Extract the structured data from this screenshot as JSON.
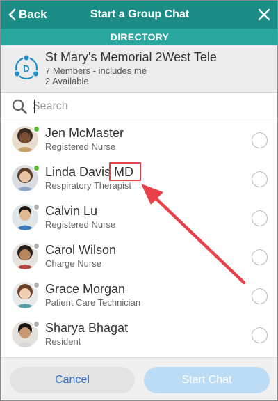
{
  "header": {
    "back_label": "Back",
    "title": "Start a Group Chat",
    "subtitle": "DIRECTORY"
  },
  "group": {
    "icon_letter": "D",
    "name": "St Mary's Memorial 2West Tele",
    "members": "7 Members - includes me",
    "available": "2 Available"
  },
  "search": {
    "placeholder": "Search",
    "value": ""
  },
  "contacts": [
    {
      "name": "Jen McMaster",
      "role": "Registered Nurse",
      "status": "available"
    },
    {
      "name": "Linda Davis MD",
      "role": "Respiratory Therapist",
      "status": "available"
    },
    {
      "name": "Calvin Lu",
      "role": "Registered Nurse",
      "status": "offline"
    },
    {
      "name": "Carol Wilson",
      "role": "Charge Nurse",
      "status": "offline"
    },
    {
      "name": "Grace Morgan",
      "role": "Patient Care Technician",
      "status": "offline"
    },
    {
      "name": "Sharya Bhagat",
      "role": "Resident",
      "status": "offline"
    }
  ],
  "footer": {
    "cancel_label": "Cancel",
    "start_label": "Start Chat"
  },
  "colors": {
    "header": "#1b8c86",
    "subheader": "#2aa79f",
    "available": "#5bc236",
    "offline": "#b3b3b3",
    "annotation": "#e8414a",
    "cancel_text": "#2f6fcf",
    "start_disabled": "#bcdcf5"
  },
  "icons": {
    "back": "chevron-left-icon",
    "close": "close-icon",
    "group": "group-network-icon",
    "search": "search-icon"
  }
}
